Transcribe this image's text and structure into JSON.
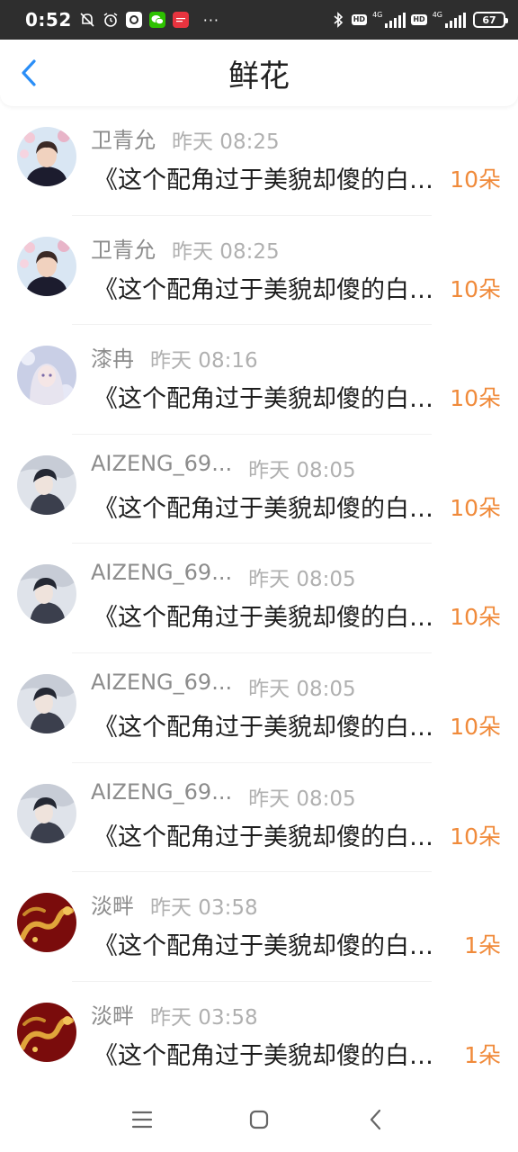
{
  "status_bar": {
    "time": "0:52",
    "network_1": "4G",
    "network_2": "4G",
    "hd_1": "HD",
    "hd_2": "HD",
    "battery": "67",
    "dots": "···",
    "app_icons": [
      "mute-bell-icon",
      "alarm-icon",
      "app-icon",
      "wechat-icon",
      "news-app-icon"
    ]
  },
  "header": {
    "title": "鲜花",
    "back_icon": "chevron-left-icon",
    "accent": "#2a8ef7"
  },
  "colors": {
    "amount": "#f08a3a",
    "name": "#8c8c8c",
    "time": "#b0b0b0",
    "title": "#1e1e1e"
  },
  "items": [
    {
      "name": "卫青允",
      "time": "昨天 08:25",
      "title": "《这个配角过于美貌却傻的白月光",
      "amount": "10朵",
      "avatar": "avatar-boy-flowers"
    },
    {
      "name": "卫青允",
      "time": "昨天 08:25",
      "title": "《这个配角过于美貌却傻的白月光",
      "amount": "10朵",
      "avatar": "avatar-boy-flowers"
    },
    {
      "name": "漆冉",
      "time": "昨天 08:16",
      "title": "《这个配角过于美貌却傻的白月光",
      "amount": "10朵",
      "avatar": "avatar-anime-girl"
    },
    {
      "name": "AIZENG_69...",
      "time": "昨天 08:05",
      "title": "《这个配角过于美貌却傻的白月光",
      "amount": "10朵",
      "avatar": "avatar-anime-boy"
    },
    {
      "name": "AIZENG_69...",
      "time": "昨天 08:05",
      "title": "《这个配角过于美貌却傻的白月光",
      "amount": "10朵",
      "avatar": "avatar-anime-boy"
    },
    {
      "name": "AIZENG_69...",
      "time": "昨天 08:05",
      "title": "《这个配角过于美貌却傻的白月光",
      "amount": "10朵",
      "avatar": "avatar-anime-boy"
    },
    {
      "name": "AIZENG_69...",
      "time": "昨天 08:05",
      "title": "《这个配角过于美貌却傻的白月光",
      "amount": "10朵",
      "avatar": "avatar-anime-boy"
    },
    {
      "name": "淡畔",
      "time": "昨天 03:58",
      "title": "《这个配角过于美貌却傻的白月光",
      "amount": "1朵",
      "avatar": "avatar-golden-dragon"
    },
    {
      "name": "淡畔",
      "time": "昨天 03:58",
      "title": "《这个配角过于美貌却傻的白月光",
      "amount": "1朵",
      "avatar": "avatar-golden-dragon"
    }
  ],
  "nav": {
    "menu_icon": "menu-icon",
    "home_icon": "home-icon",
    "back_icon": "back-icon"
  }
}
